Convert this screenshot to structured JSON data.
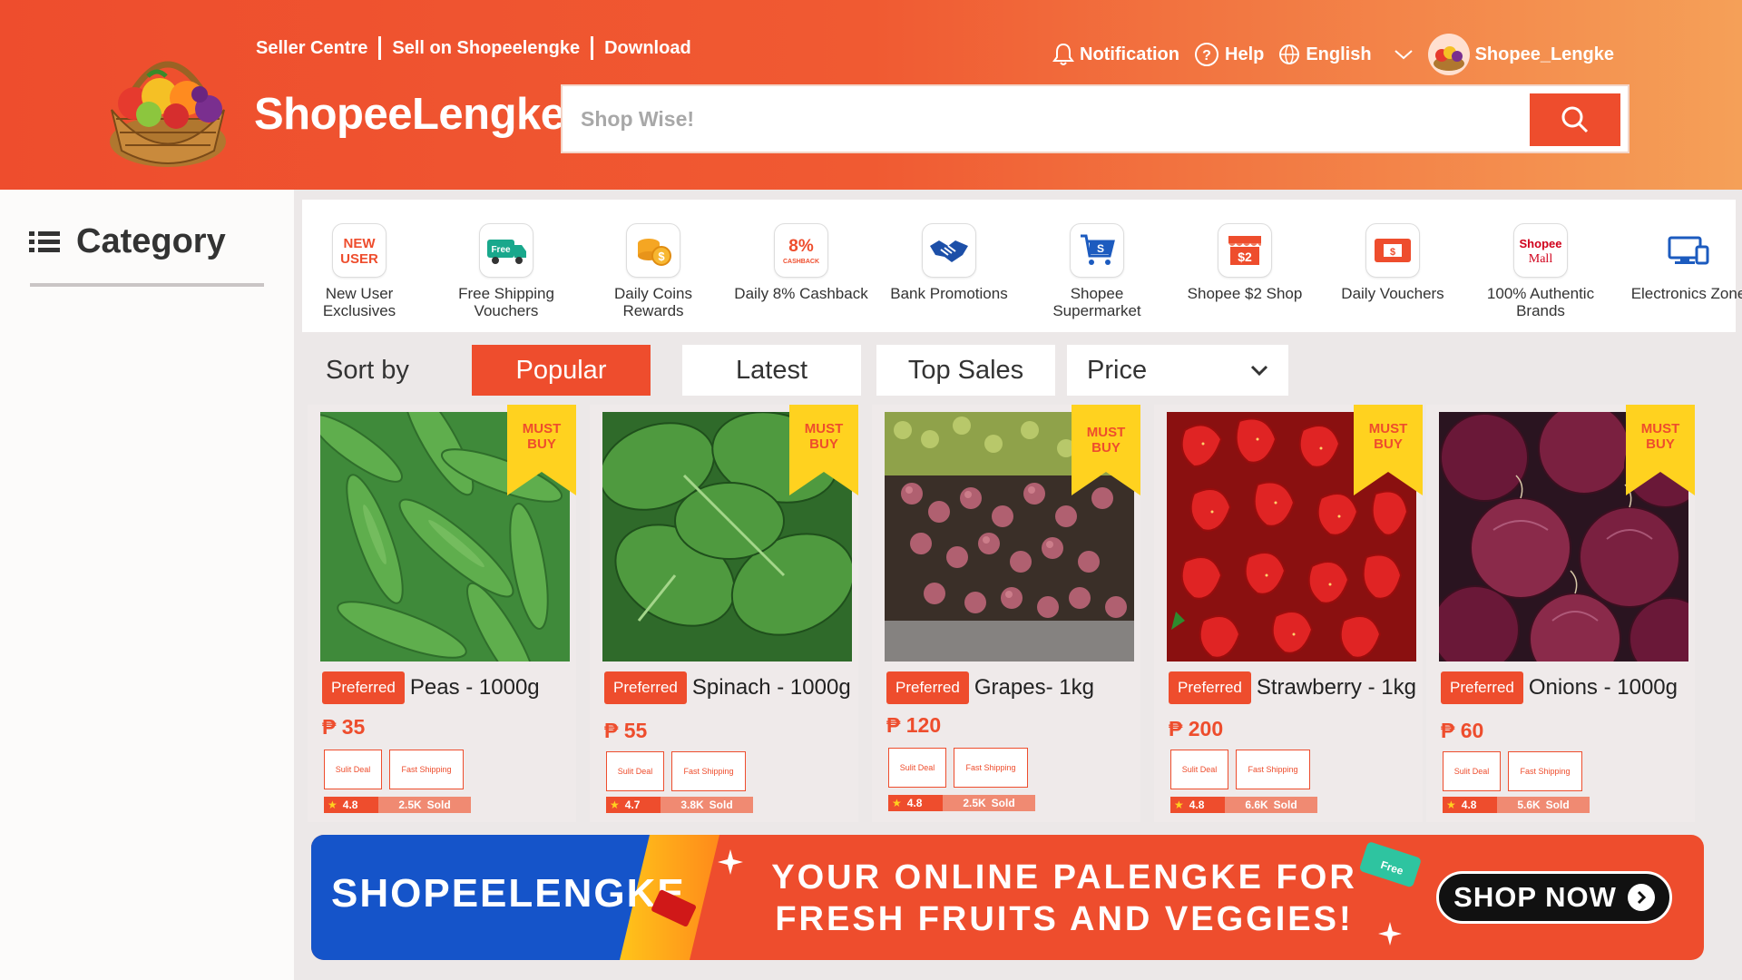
{
  "header": {
    "links": [
      "Seller Centre",
      "Sell on Shopeelengke",
      "Download"
    ],
    "brand": "ShopeeLengke",
    "search_placeholder": "Shop Wise!",
    "notification": "Notification",
    "help": "Help",
    "language": "English",
    "username": "Shopee_Lengke"
  },
  "sidebar": {
    "title": "Category"
  },
  "categories": [
    {
      "label": "New User Exclusives",
      "icon": "new-user-icon"
    },
    {
      "label": "Free Shipping Vouchers",
      "icon": "free-shipping-truck-icon"
    },
    {
      "label": "Daily Coins Rewards",
      "icon": "coins-icon"
    },
    {
      "label": "Daily 8% Cashback",
      "icon": "cashback-icon"
    },
    {
      "label": "Bank Promotions",
      "icon": "handshake-icon"
    },
    {
      "label": "Shopee Supermarket",
      "icon": "shopping-cart-icon"
    },
    {
      "label": "Shopee $2 Shop",
      "icon": "two-dollar-shop-icon"
    },
    {
      "label": "Daily Vouchers",
      "icon": "voucher-icon"
    },
    {
      "label": "100% Authentic Brands",
      "icon": "shopee-mall-icon"
    },
    {
      "label": "Electronics Zone",
      "icon": "electronics-icon"
    }
  ],
  "sort": {
    "label": "Sort by",
    "options": [
      "Popular",
      "Latest",
      "Top Sales"
    ],
    "active": "Popular",
    "price": "Price"
  },
  "products": [
    {
      "name": "Peas - 1000g",
      "price": "₱ 35",
      "rating": "4.8",
      "sold": "2.5K",
      "badge": "MUST BUY",
      "preferred": "Preferred",
      "tag1": "Sulit Deal",
      "tag2": "Fast Shipping",
      "sold_label": "Sold"
    },
    {
      "name": "Spinach - 1000g",
      "price": "₱ 55",
      "rating": "4.7",
      "sold": "3.8K",
      "badge": "MUST BUY",
      "preferred": "Preferred",
      "tag1": "Sulit Deal",
      "tag2": "Fast Shipping",
      "sold_label": "Sold"
    },
    {
      "name": "Grapes- 1kg",
      "price": "₱ 120",
      "rating": "4.8",
      "sold": "2.5K",
      "badge": "MUST BUY",
      "preferred": "Preferred",
      "tag1": "Sulit Deal",
      "tag2": "Fast Shipping",
      "sold_label": "Sold"
    },
    {
      "name": "Strawberry - 1kg",
      "price": "₱ 200",
      "rating": "4.8",
      "sold": "6.6K",
      "badge": "MUST BUY",
      "preferred": "Preferred",
      "tag1": "Sulit Deal",
      "tag2": "Fast Shipping",
      "sold_label": "Sold"
    },
    {
      "name": "Onions - 1000g",
      "price": "₱ 60",
      "rating": "4.8",
      "sold": "5.6K",
      "badge": "MUST BUY",
      "preferred": "Preferred",
      "tag1": "Sulit Deal",
      "tag2": "Fast Shipping",
      "sold_label": "Sold"
    }
  ],
  "banner": {
    "brand": "SHOPEELENGKE",
    "message_line1": "YOUR ONLINE PALENGKE FOR",
    "message_line2": "FRESH FRUITS AND VEGGIES!",
    "cta": "SHOP NOW"
  },
  "colors": {
    "primary": "#ee4d2d",
    "banner_blue": "#1554c9",
    "badge_yellow": "#ffd21f"
  }
}
